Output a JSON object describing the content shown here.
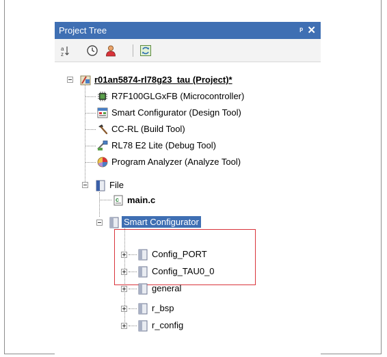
{
  "panel": {
    "title": "Project Tree",
    "pin_glyph": "ᵖ",
    "close_glyph": "✕"
  },
  "toolbar": {
    "icons": [
      "sort-icon",
      "clock-icon",
      "user-icon",
      "refresh-icon"
    ]
  },
  "tree": {
    "project": "r01an5874-rl78g23_tau (Project)*",
    "items": [
      {
        "label": "R7F100GLGxFB (Microcontroller)",
        "icon": "chip-icon"
      },
      {
        "label": "Smart Configurator (Design Tool)",
        "icon": "design-tool-icon"
      },
      {
        "label": "CC-RL (Build Tool)",
        "icon": "hammer-icon"
      },
      {
        "label": "RL78 E2 Lite (Debug Tool)",
        "icon": "debugger-icon"
      },
      {
        "label": "Program Analyzer (Analyze Tool)",
        "icon": "analyzer-icon"
      }
    ],
    "file_folder": "File",
    "main_file": "main.c",
    "smart_configurator": "Smart Configurator",
    "sc_children": [
      "Config_PORT",
      "Config_TAU0_0",
      "general",
      "r_bsp",
      "r_config"
    ]
  },
  "colors": {
    "title_bar": "#3f6fb3",
    "selection": "#3f6fb3",
    "highlight_box": "#d9333a"
  }
}
